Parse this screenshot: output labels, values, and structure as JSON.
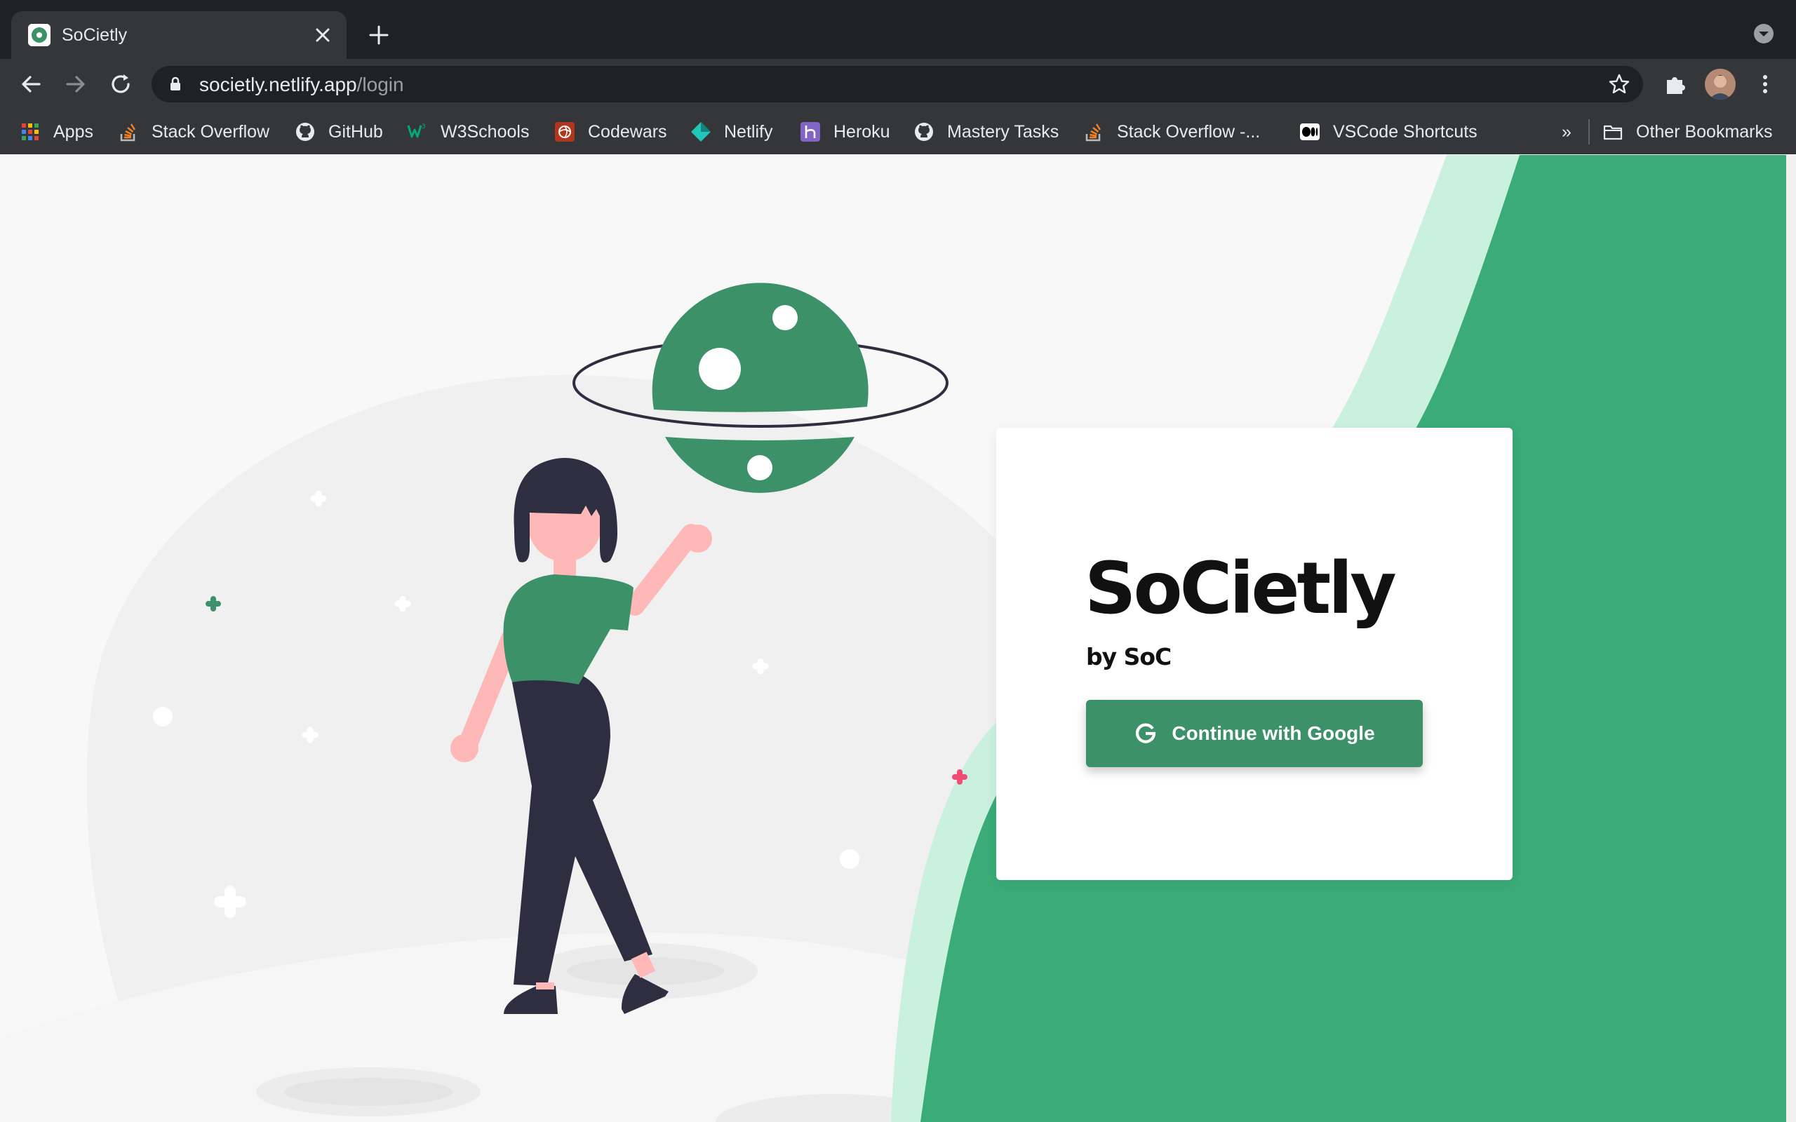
{
  "browser": {
    "tab_title": "SoCietly",
    "url_host": "societly.netlify.app",
    "url_path": "/login"
  },
  "bookmarks": [
    {
      "label": "Apps",
      "icon": "apps-grid-icon"
    },
    {
      "label": "Stack Overflow",
      "icon": "stackoverflow-icon"
    },
    {
      "label": "GitHub",
      "icon": "github-icon"
    },
    {
      "label": "W3Schools",
      "icon": "w3schools-icon"
    },
    {
      "label": "Codewars",
      "icon": "codewars-icon"
    },
    {
      "label": "Netlify",
      "icon": "netlify-icon"
    },
    {
      "label": "Heroku",
      "icon": "heroku-icon"
    },
    {
      "label": "Mastery Tasks",
      "icon": "github-icon"
    },
    {
      "label": "Stack Overflow -...",
      "icon": "stackoverflow-icon"
    },
    {
      "label": "VSCode Shortcuts",
      "icon": "medium-icon"
    }
  ],
  "bookmarks_overflow": "»",
  "other_bookmarks": "Other Bookmarks",
  "login": {
    "brand": "SoCietly",
    "subtitle": "by SoC",
    "google_button": "Continue with Google"
  },
  "colors": {
    "accent": "#3c9168",
    "accent_light": "#c9f1dd",
    "wave": "#3bab78",
    "chrome_dark": "#202124",
    "chrome_mid": "#35363a",
    "figure_dark": "#2f2e41",
    "figure_skin": "#ffb8b8",
    "star_pink": "#f24e74"
  }
}
